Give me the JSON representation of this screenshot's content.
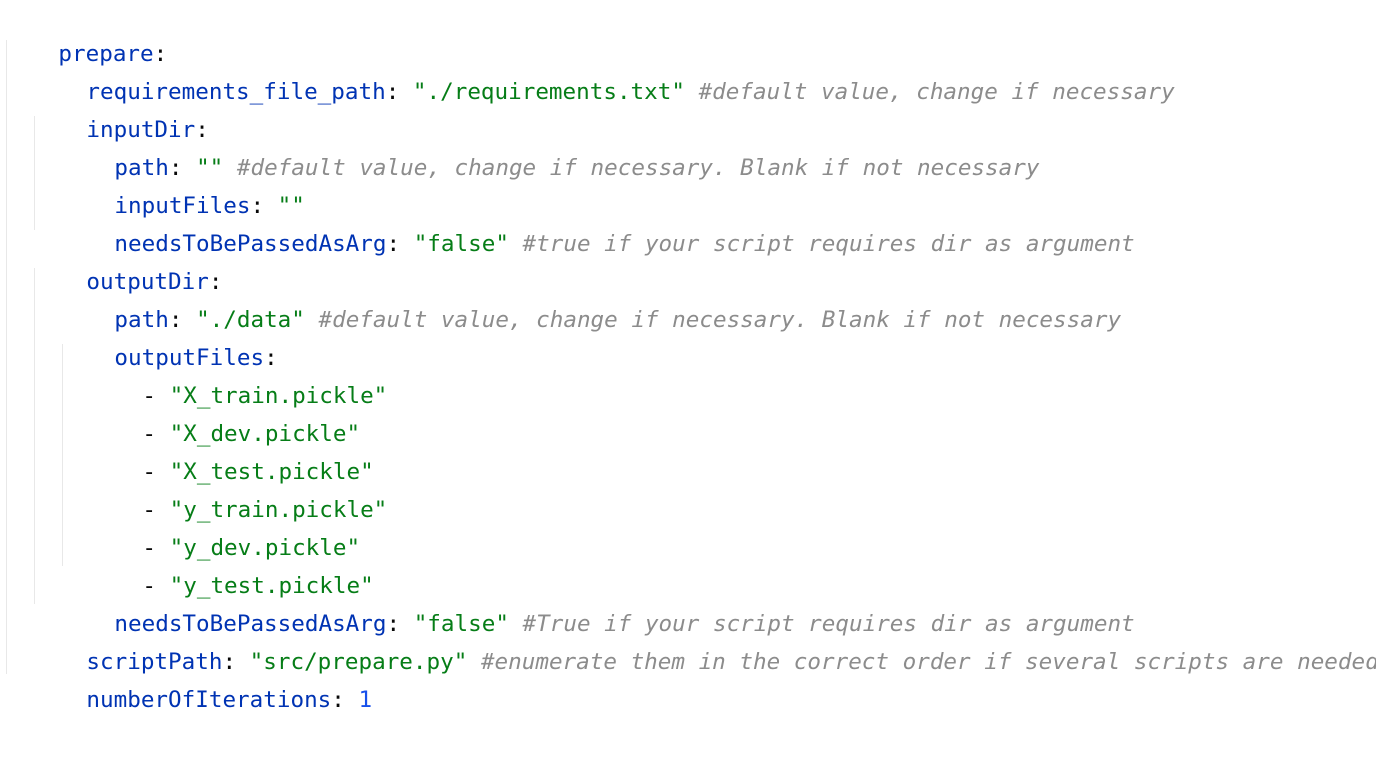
{
  "colors": {
    "key": "#0033b3",
    "string": "#067d17",
    "number": "#1750eb",
    "comment": "#8c8c8c",
    "text": "#080808",
    "background": "#ffffff"
  },
  "lines": [
    {
      "key": "prepare",
      "colon": ":"
    },
    {
      "key": "requirements_file_path",
      "colon": ":",
      "value": "\"./requirements.txt\"",
      "comment": "#default value, change if necessary"
    },
    {
      "key": "inputDir",
      "colon": ":"
    },
    {
      "key": "path",
      "colon": ":",
      "value": "\"\"",
      "comment": "#default value, change if necessary. Blank if not necessary"
    },
    {
      "key": "inputFiles",
      "colon": ":",
      "value": "\"\""
    },
    {
      "key": "needsToBePassedAsArg",
      "colon": ":",
      "value": "\"false\"",
      "comment": "#true if your script requires dir as argument"
    },
    {
      "key": "outputDir",
      "colon": ":"
    },
    {
      "key": "path",
      "colon": ":",
      "value": "\"./data\"",
      "comment": "#default value, change if necessary. Blank if not necessary"
    },
    {
      "key": "outputFiles",
      "colon": ":"
    },
    {
      "dash": "-",
      "value": "\"X_train.pickle\""
    },
    {
      "dash": "-",
      "value": "\"X_dev.pickle\""
    },
    {
      "dash": "-",
      "value": "\"X_test.pickle\""
    },
    {
      "dash": "-",
      "value": "\"y_train.pickle\""
    },
    {
      "dash": "-",
      "value": "\"y_dev.pickle\""
    },
    {
      "dash": "-",
      "value": "\"y_test.pickle\""
    },
    {
      "key": "needsToBePassedAsArg",
      "colon": ":",
      "value": "\"false\"",
      "comment": "#True if your script requires dir as argument"
    },
    {
      "key": "scriptPath",
      "colon": ":",
      "value": "\"src/prepare.py\"",
      "comment": "#enumerate them in the correct order if several scripts are needed"
    },
    {
      "key": "numberOfIterations",
      "colon": ":",
      "number": "1"
    }
  ]
}
